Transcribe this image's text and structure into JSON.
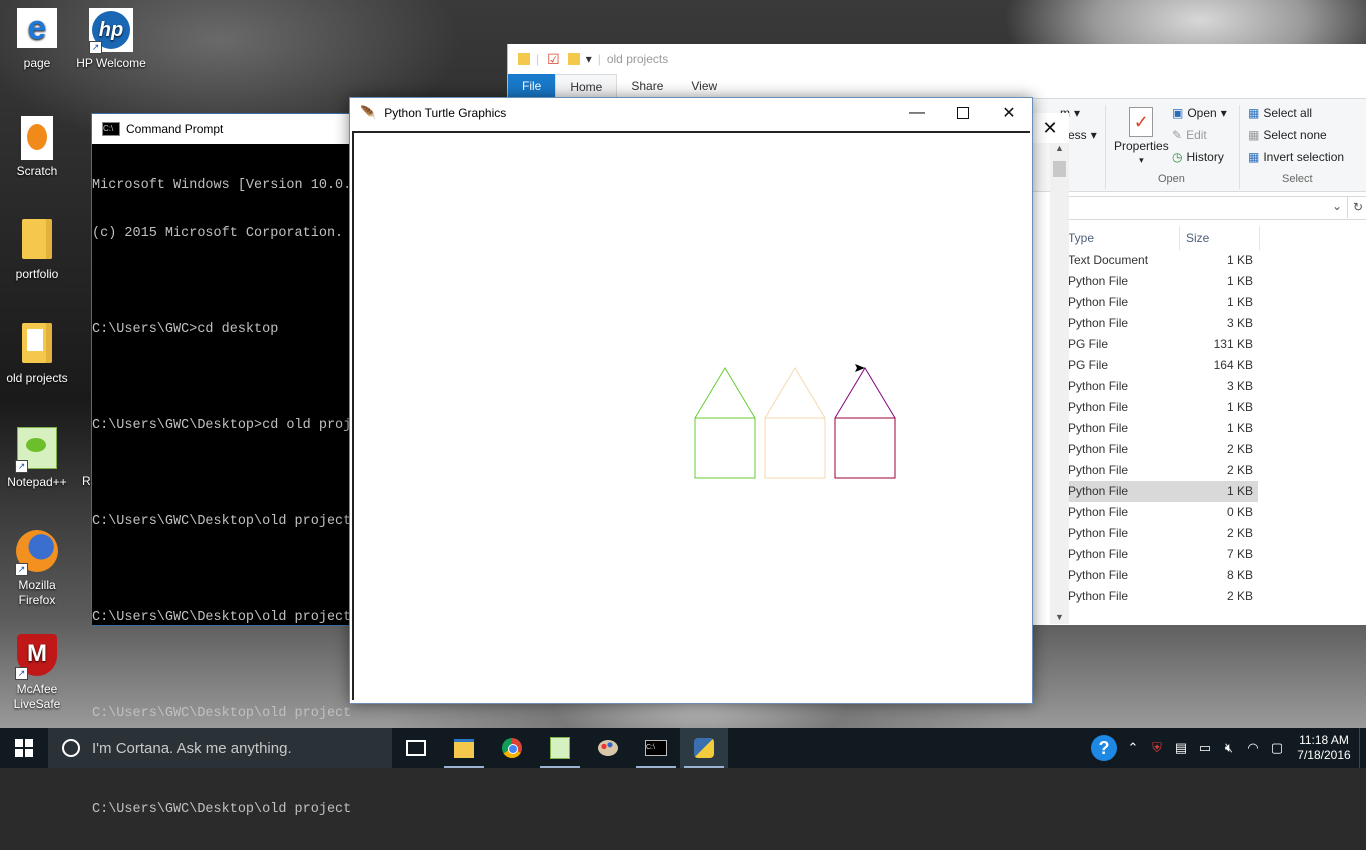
{
  "desktop": {
    "icons": [
      {
        "label": "page",
        "icon": "edge-icon"
      },
      {
        "label": "HP Welcome",
        "icon": "hp-logo-icon"
      },
      {
        "label": "Scratch",
        "icon": "scratch-icon"
      },
      {
        "label": "portfolio",
        "icon": "folder-icon"
      },
      {
        "label": "old projects",
        "icon": "folder-icon"
      },
      {
        "label": "Notepad++",
        "icon": "notepadpp-icon"
      },
      {
        "label": "Mozilla Firefox",
        "icon": "firefox-icon"
      },
      {
        "label": "McAfee LiveSafe",
        "icon": "mcafee-icon"
      }
    ],
    "partial_label": "Re"
  },
  "cmd": {
    "title": "Command Prompt",
    "lines": [
      "Microsoft Windows [Version 10.0.",
      "(c) 2015 Microsoft Corporation.",
      "",
      "C:\\Users\\GWC>cd desktop",
      "",
      "C:\\Users\\GWC\\Desktop>cd old proj",
      "",
      "C:\\Users\\GWC\\Desktop\\old project",
      "",
      "C:\\Users\\GWC\\Desktop\\old project",
      "",
      "C:\\Users\\GWC\\Desktop\\old project",
      "",
      "C:\\Users\\GWC\\Desktop\\old project"
    ]
  },
  "explorer": {
    "title": "old projects",
    "tabs": [
      "File",
      "Home",
      "Share",
      "View"
    ],
    "ribbon": {
      "partial_items": [
        "m",
        "ess"
      ],
      "properties": "Properties",
      "open": "Open",
      "edit": "Edit",
      "history": "History",
      "open_group": "Open",
      "select_all": "Select all",
      "select_none": "Select none",
      "invert_selection": "Invert selection",
      "select_group": "Select"
    },
    "columns": {
      "type": "Type",
      "size": "Size"
    },
    "files": [
      {
        "type": "Text Document",
        "size": "1 KB"
      },
      {
        "type": "Python File",
        "size": "1 KB"
      },
      {
        "type": "Python File",
        "size": "1 KB"
      },
      {
        "type": "Python File",
        "size": "3 KB"
      },
      {
        "type": "PG File",
        "size": "131 KB"
      },
      {
        "type": "PG File",
        "size": "164 KB"
      },
      {
        "type": "Python File",
        "size": "3 KB"
      },
      {
        "type": "Python File",
        "size": "1 KB"
      },
      {
        "type": "Python File",
        "size": "1 KB"
      },
      {
        "type": "Python File",
        "size": "2 KB"
      },
      {
        "type": "Python File",
        "size": "2 KB"
      },
      {
        "type": "Python File",
        "size": "1 KB",
        "selected": true
      },
      {
        "type": "Python File",
        "size": "0 KB"
      },
      {
        "type": "Python File",
        "size": "2 KB"
      },
      {
        "type": "Python File",
        "size": "7 KB"
      },
      {
        "type": "Python File",
        "size": "8 KB"
      },
      {
        "type": "Python File",
        "size": "2 KB"
      }
    ]
  },
  "turtle": {
    "title": "Python Turtle Graphics",
    "houses": [
      {
        "color": "#66cc33"
      },
      {
        "color": "#f5d9b0"
      },
      {
        "color": "#990033",
        "roof_color": "#800080",
        "has_turtle": true
      }
    ]
  },
  "taskbar": {
    "search_placeholder": "I'm Cortana. Ask me anything.",
    "apps": [
      "task-view-icon",
      "file-explorer-icon",
      "chrome-icon",
      "notepadpp-icon",
      "paint-icon",
      "cmd-icon",
      "python-icon"
    ],
    "time": "11:18 AM",
    "date": "7/18/2016"
  }
}
